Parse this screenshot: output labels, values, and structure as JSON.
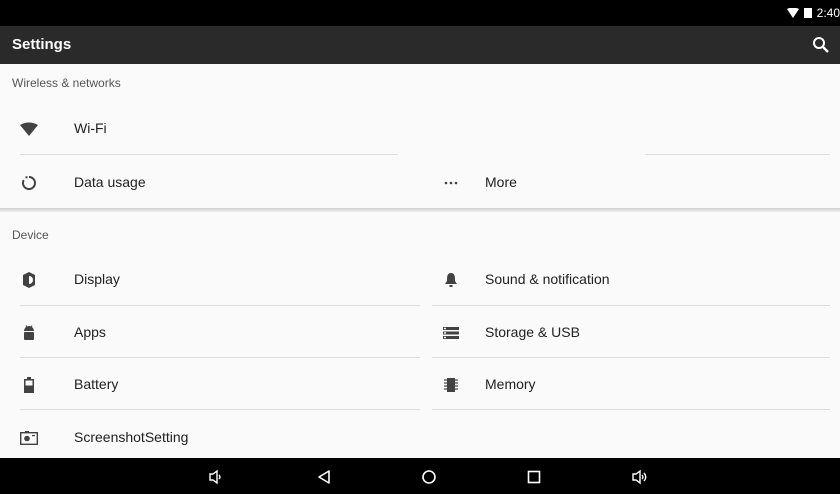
{
  "status": {
    "time": "2:40"
  },
  "appbar": {
    "title": "Settings"
  },
  "wireless": {
    "header": "Wireless & networks",
    "items": [
      {
        "label": "Wi-Fi",
        "icon": "wifi-icon"
      },
      {
        "label": "Data usage",
        "icon": "data-usage-icon"
      },
      {
        "label": "More",
        "icon": "more-icon"
      }
    ]
  },
  "device": {
    "header": "Device",
    "items": [
      {
        "label": "Display",
        "icon": "brightness-icon"
      },
      {
        "label": "Sound & notification",
        "icon": "bell-icon"
      },
      {
        "label": "Apps",
        "icon": "android-icon"
      },
      {
        "label": "Storage & USB",
        "icon": "storage-icon"
      },
      {
        "label": "Battery",
        "icon": "battery-icon"
      },
      {
        "label": "Memory",
        "icon": "memory-chip-icon"
      },
      {
        "label": "ScreenshotSetting",
        "icon": "screenshot-icon"
      }
    ]
  },
  "navbar": {
    "icons": [
      "volume-down-icon",
      "back-icon",
      "home-icon",
      "recents-icon",
      "volume-up-icon"
    ]
  },
  "colors": {
    "statusbar": "#000000",
    "appbar": "#2a2a2a",
    "background": "#fafafa",
    "icon": "#424242"
  }
}
